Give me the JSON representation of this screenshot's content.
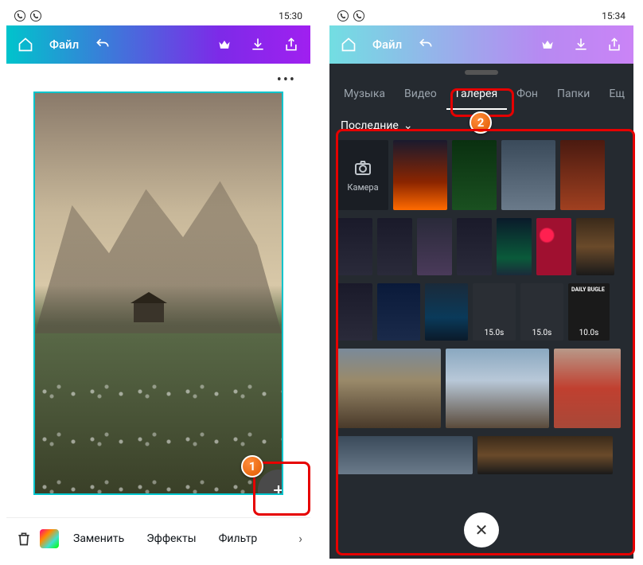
{
  "status": {
    "time_left": "15:30",
    "time_right": "15:34"
  },
  "appbar": {
    "file_label": "Файл"
  },
  "canvas": {
    "more": "•••"
  },
  "fab": {
    "plus": "+"
  },
  "bottom": {
    "replace": "Заменить",
    "effects": "Эффекты",
    "filter": "Фильтр",
    "chev": "›"
  },
  "tabs": {
    "music": "Музыка",
    "video": "Видео",
    "gallery": "Галерея",
    "bg": "Фон",
    "folders": "Папки",
    "more": "Ещ"
  },
  "gallery": {
    "filter": "Последние",
    "camera": "Камера",
    "d15": "15.0s",
    "d10": "10.0s",
    "bugle": "DAILY BUGLE"
  },
  "close": {
    "x": "✕"
  },
  "ann": {
    "one": "1",
    "two": "2"
  }
}
